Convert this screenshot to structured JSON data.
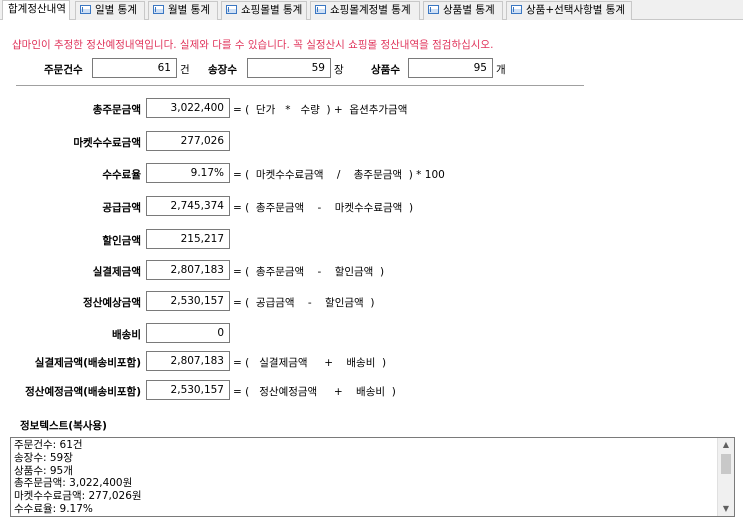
{
  "tabs": [
    {
      "label": "합계정산내역",
      "active": true
    },
    {
      "label": "일별 통계",
      "icon": "form-icon"
    },
    {
      "label": "월별 통계",
      "icon": "form-icon"
    },
    {
      "label": "쇼핑몰별 통계",
      "icon": "form-icon"
    },
    {
      "label": "쇼핑몰계정별 통계",
      "icon": "form-icon"
    },
    {
      "label": "상품별 통계",
      "icon": "form-icon"
    },
    {
      "label": "상품+선택사항별 통계",
      "icon": "form-icon"
    }
  ],
  "notice": "샵마인이 추정한 정산예정내역입니다. 실제와 다를 수 있습니다. 꼭 실정산시 쇼핑몰 정산내역을 점검하십시오.",
  "notice_color": "#e0345b",
  "summary": {
    "order_count": {
      "label": "주문건수",
      "value": "61",
      "unit": "건"
    },
    "invoice_count": {
      "label": "송장수",
      "value": "59",
      "unit": "장"
    },
    "product_count": {
      "label": "상품수",
      "value": "95",
      "unit": "개"
    }
  },
  "rows": [
    {
      "label": "총주문금액",
      "value": "3,022,400",
      "formula": "= (  단가   *   수량  ) +  옵션추가금액"
    },
    {
      "label": "마켓수수료금액",
      "value": "277,026",
      "formula": ""
    },
    {
      "label": "수수료율",
      "value": "9.17%",
      "formula": "= (  마켓수수료금액    /    총주문금액  ) * 100"
    },
    {
      "label": "공급금액",
      "value": "2,745,374",
      "formula": "= (  총주문금액    -    마켓수수료금액  )"
    },
    {
      "label": "할인금액",
      "value": "215,217",
      "formula": ""
    },
    {
      "label": "실결제금액",
      "value": "2,807,183",
      "formula": "= (  총주문금액    -    할인금액  )"
    },
    {
      "label": "정산예상금액",
      "value": "2,530,157",
      "formula": "= (  공급금액    -    할인금액  )"
    },
    {
      "label": "배송비",
      "value": "0",
      "formula": ""
    },
    {
      "label": "실결제금액(배송비포함)",
      "value": "2,807,183",
      "formula": "= (   실결제금액     +    배송비  )"
    },
    {
      "label": "정산예정금액(배송비포함)",
      "value": "2,530,157",
      "formula": "= (   정산예정금액     +    배송비  )"
    }
  ],
  "info": {
    "label": "정보텍스트(복사용)",
    "lines": [
      "주문건수: 61건",
      "송장수: 59장",
      "상품수: 95개",
      "총주문금액: 3,022,400원",
      "마켓수수료금액: 277,026원",
      "수수료율: 9.17%"
    ]
  }
}
